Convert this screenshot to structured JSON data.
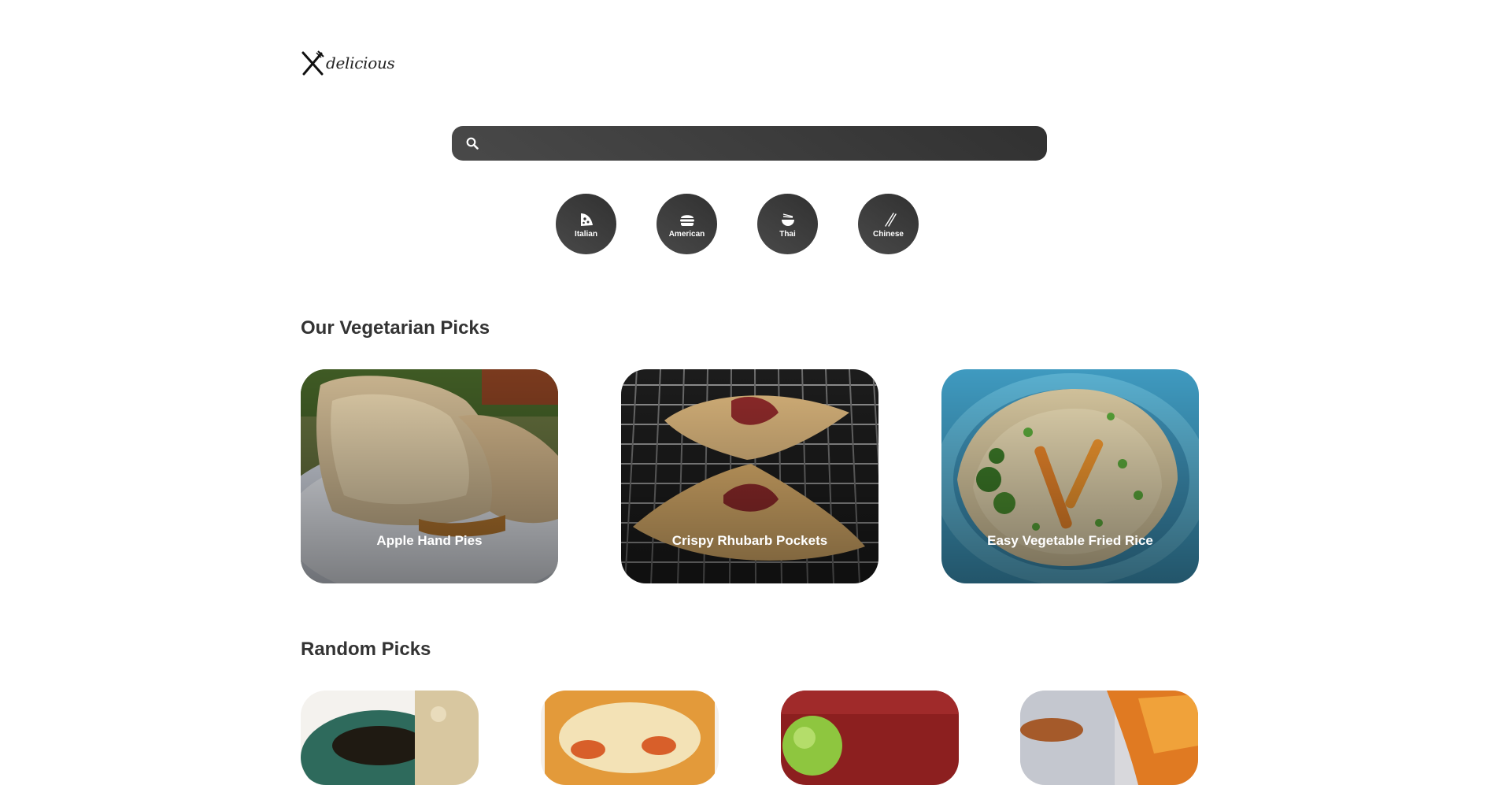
{
  "logo": {
    "text": "delicious"
  },
  "search": {
    "value": "",
    "placeholder": ""
  },
  "categories": [
    {
      "label": "Italian",
      "icon": "pizza-icon"
    },
    {
      "label": "American",
      "icon": "burger-icon"
    },
    {
      "label": "Thai",
      "icon": "noodle-bowl-icon"
    },
    {
      "label": "Chinese",
      "icon": "chopsticks-icon"
    }
  ],
  "veggie": {
    "heading": "Our Vegetarian Picks",
    "cards": [
      {
        "title": "Apple Hand Pies"
      },
      {
        "title": "Crispy Rhubarb Pockets"
      },
      {
        "title": "Easy Vegetable Fried Rice"
      }
    ]
  },
  "random": {
    "heading": "Random Picks"
  },
  "colors": {
    "accent_dark": "#313131",
    "accent_light": "#494949",
    "text": "#333333"
  }
}
